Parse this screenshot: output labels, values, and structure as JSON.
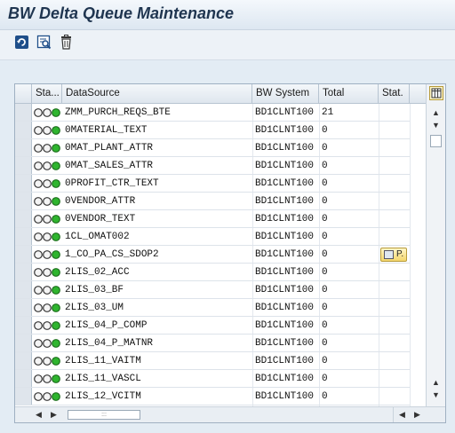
{
  "title": "BW Delta Queue Maintenance",
  "toolbar": {
    "buttons": [
      {
        "name": "refresh-icon"
      },
      {
        "name": "details-icon"
      },
      {
        "name": "delete-icon"
      }
    ]
  },
  "table": {
    "columns": {
      "sta": "Sta...",
      "datasource": "DataSource",
      "bw_system": "BW System",
      "total": "Total",
      "stat": "Stat."
    },
    "rows": [
      {
        "datasource": "ZMM_PURCH_REQS_BTE",
        "bw_system": "BD1CLNT100",
        "total": "21",
        "stat": ""
      },
      {
        "datasource": "0MATERIAL_TEXT",
        "bw_system": "BD1CLNT100",
        "total": "0",
        "stat": ""
      },
      {
        "datasource": "0MAT_PLANT_ATTR",
        "bw_system": "BD1CLNT100",
        "total": "0",
        "stat": ""
      },
      {
        "datasource": "0MAT_SALES_ATTR",
        "bw_system": "BD1CLNT100",
        "total": "0",
        "stat": ""
      },
      {
        "datasource": "0PROFIT_CTR_TEXT",
        "bw_system": "BD1CLNT100",
        "total": "0",
        "stat": ""
      },
      {
        "datasource": "0VENDOR_ATTR",
        "bw_system": "BD1CLNT100",
        "total": "0",
        "stat": ""
      },
      {
        "datasource": "0VENDOR_TEXT",
        "bw_system": "BD1CLNT100",
        "total": "0",
        "stat": ""
      },
      {
        "datasource": "1CL_OMAT002",
        "bw_system": "BD1CLNT100",
        "total": "0",
        "stat": ""
      },
      {
        "datasource": "1_CO_PA_CS_SDOP2",
        "bw_system": "BD1CLNT100",
        "total": "0",
        "stat": "P."
      },
      {
        "datasource": "2LIS_02_ACC",
        "bw_system": "BD1CLNT100",
        "total": "0",
        "stat": ""
      },
      {
        "datasource": "2LIS_03_BF",
        "bw_system": "BD1CLNT100",
        "total": "0",
        "stat": ""
      },
      {
        "datasource": "2LIS_03_UM",
        "bw_system": "BD1CLNT100",
        "total": "0",
        "stat": ""
      },
      {
        "datasource": "2LIS_04_P_COMP",
        "bw_system": "BD1CLNT100",
        "total": "0",
        "stat": ""
      },
      {
        "datasource": "2LIS_04_P_MATNR",
        "bw_system": "BD1CLNT100",
        "total": "0",
        "stat": ""
      },
      {
        "datasource": "2LIS_11_VAITM",
        "bw_system": "BD1CLNT100",
        "total": "0",
        "stat": ""
      },
      {
        "datasource": "2LIS_11_VASCL",
        "bw_system": "BD1CLNT100",
        "total": "0",
        "stat": ""
      },
      {
        "datasource": "2LIS_12_VCITM",
        "bw_system": "BD1CLNT100",
        "total": "0",
        "stat": ""
      }
    ]
  },
  "colors": {
    "title": "#1f3550",
    "light_off": "#f4f4f4",
    "light_on": "#2fb52f"
  }
}
